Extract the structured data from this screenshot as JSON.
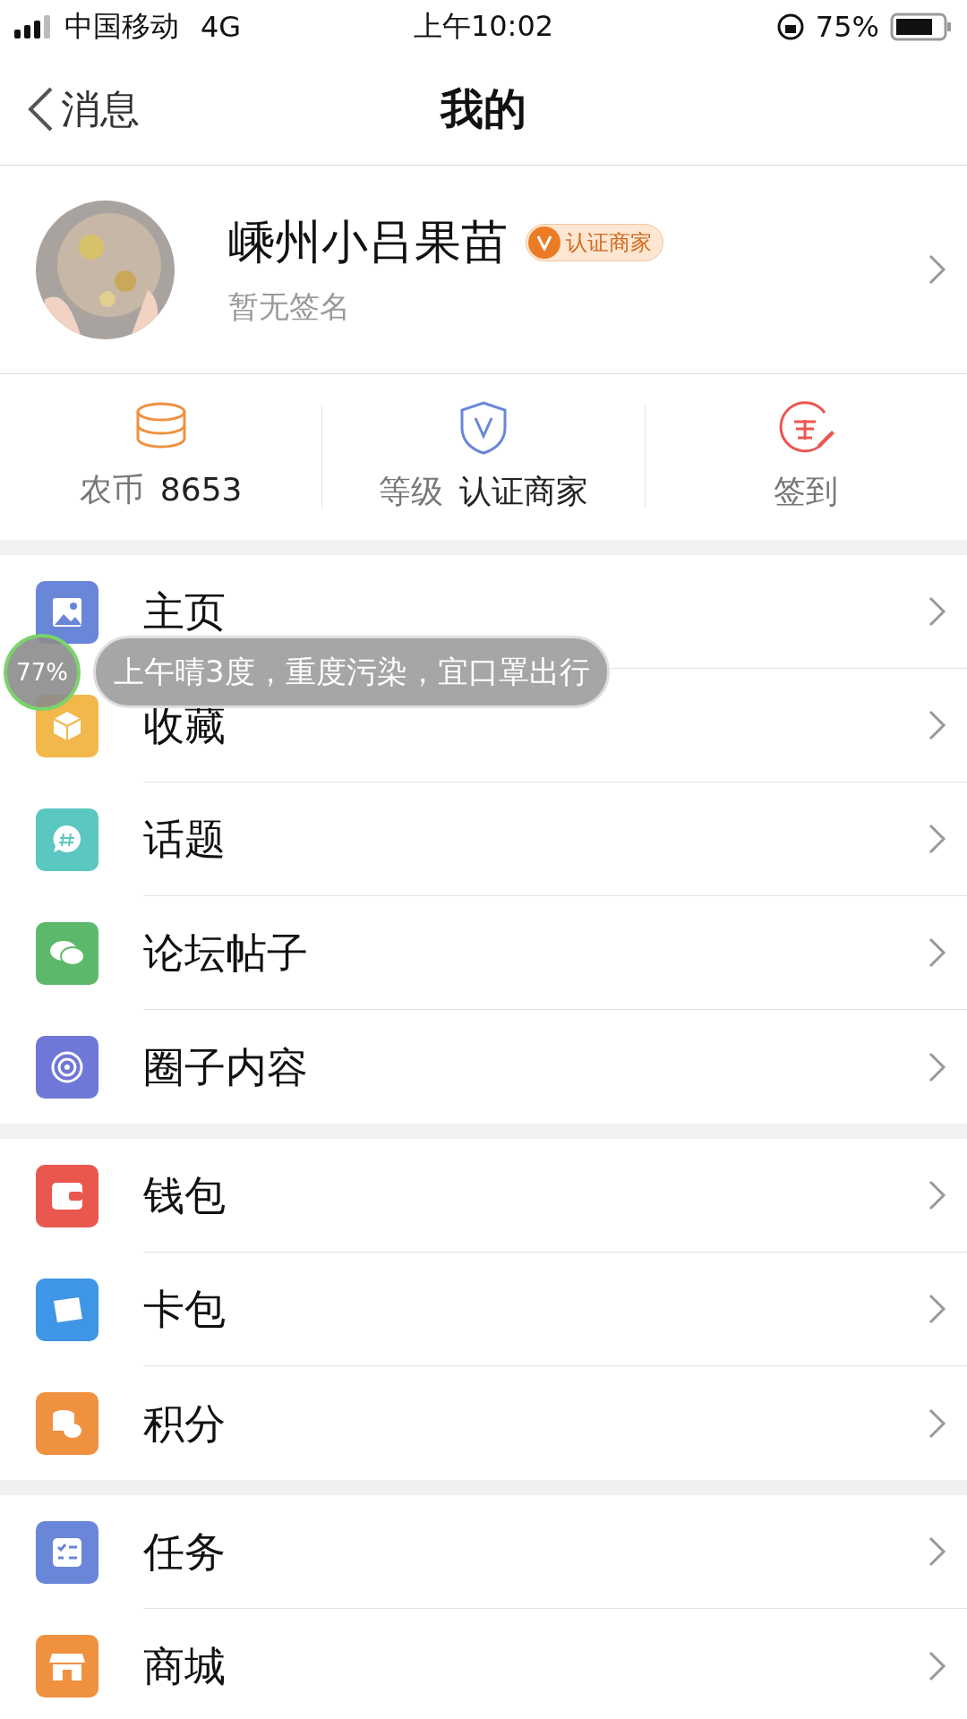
{
  "status_bar": {
    "carrier": "中国移动",
    "network": "4G",
    "time": "上午10:02",
    "battery": "75%"
  },
  "nav": {
    "back": "消息",
    "title": "我的"
  },
  "profile": {
    "name": "嵊州小吕果苗",
    "badge": "认证商家",
    "signature": "暂无签名"
  },
  "stats": [
    {
      "kind": "coins",
      "label": "农币",
      "value": "8653"
    },
    {
      "kind": "level",
      "label": "等级",
      "value": "认证商家"
    },
    {
      "kind": "checkin",
      "label": "签到"
    }
  ],
  "menu_groups": [
    [
      {
        "label": "主页",
        "color": "#6a86d8"
      },
      {
        "kind": "box",
        "label": "收藏",
        "color": "#f2b84b"
      },
      {
        "kind": "topic",
        "label": "话题",
        "color": "#5bc7c1"
      },
      {
        "kind": "chat",
        "label": "论坛帖子",
        "color": "#5cb96b"
      },
      {
        "kind": "circle",
        "label": "圈子内容",
        "color": "#6f78d6"
      }
    ],
    [
      {
        "kind": "wallet",
        "label": "钱包",
        "color": "#e9574f"
      },
      {
        "kind": "card",
        "label": "卡包",
        "color": "#3f95e6"
      },
      {
        "kind": "coins",
        "label": "积分",
        "color": "#f0913f"
      }
    ],
    [
      {
        "kind": "task",
        "label": "任务",
        "color": "#6a86d8"
      },
      {
        "kind": "shop",
        "label": "商城",
        "color": "#f0913f"
      }
    ]
  ],
  "toast": {
    "percent": "77%",
    "message": "上午晴3度，重度污染，宜口罩出行"
  }
}
